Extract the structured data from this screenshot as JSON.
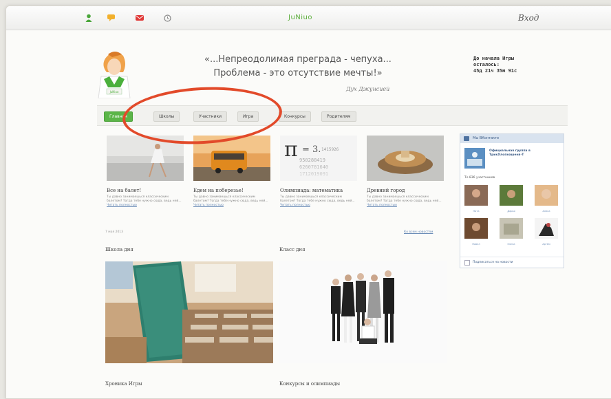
{
  "topbar": {
    "logo": "JuNiuo",
    "signin": "Вход",
    "icons": [
      "user-icon",
      "chat-icon",
      "mail-icon",
      "clock-icon"
    ]
  },
  "header": {
    "quote_line1": "«...Непреодолимая преграда - чепуха...",
    "quote_line2": "Проблема - это отсутствие мечты!»",
    "author": "Дух Джунсией",
    "countdown_line1": "До начала Игры",
    "countdown_line2": "осталось:",
    "countdown_value": "45д 21ч 35м 91с"
  },
  "nav": {
    "items": [
      {
        "label": "Главная",
        "active": true
      },
      {
        "label": "Школы"
      },
      {
        "label": "Участники"
      },
      {
        "label": "Игра"
      },
      {
        "label": "Конкурсы"
      },
      {
        "label": "Родителям"
      }
    ]
  },
  "news": [
    {
      "title": "Все на балет!",
      "text": "Ты давно занимаешься классическим балетом? Тогда тебе нужно сюда, ведь ней...",
      "more": "Читать полностью"
    },
    {
      "title": "Едем на поберезье!",
      "text": "Ты давно занимаешься классическим балетом? Тогда тебе нужно сюда, ведь ней...",
      "more": "Читать полностью"
    },
    {
      "title": "Олимпиада: математика",
      "text": "Ты давно занимаешься классическим балетом? Тогда тебе нужно сюда, ведь ней...",
      "more": "Читать полностью"
    },
    {
      "title": "Древний город",
      "text": "Ты давно занимаешься классическим балетом? Тогда тебе нужно сюда, ведь ней...",
      "more": "Читать полностью"
    }
  ],
  "news_date": "7 мая 2013",
  "all_news": "Ко всем новостям",
  "sections": {
    "school_of_day": "Школа дня",
    "class_of_day": "Класс дня",
    "game_chronicle": "Хроника Игры",
    "contests": "Конкурсы и олимпиады"
  },
  "widget": {
    "header": "Мы ВКонтакте",
    "group_name": "Официальная группа в ТрикХлопнашеня-Т",
    "members_count": "То 836 участников",
    "members": [
      "Ната",
      "Дарья",
      "Алиса",
      "Павел",
      "Елена",
      "Артём"
    ],
    "subscribe": "Подписаться на новости"
  },
  "colors": {
    "accent": "#5bb548",
    "circle": "#e24a2a",
    "vk": "#4e72a0"
  }
}
